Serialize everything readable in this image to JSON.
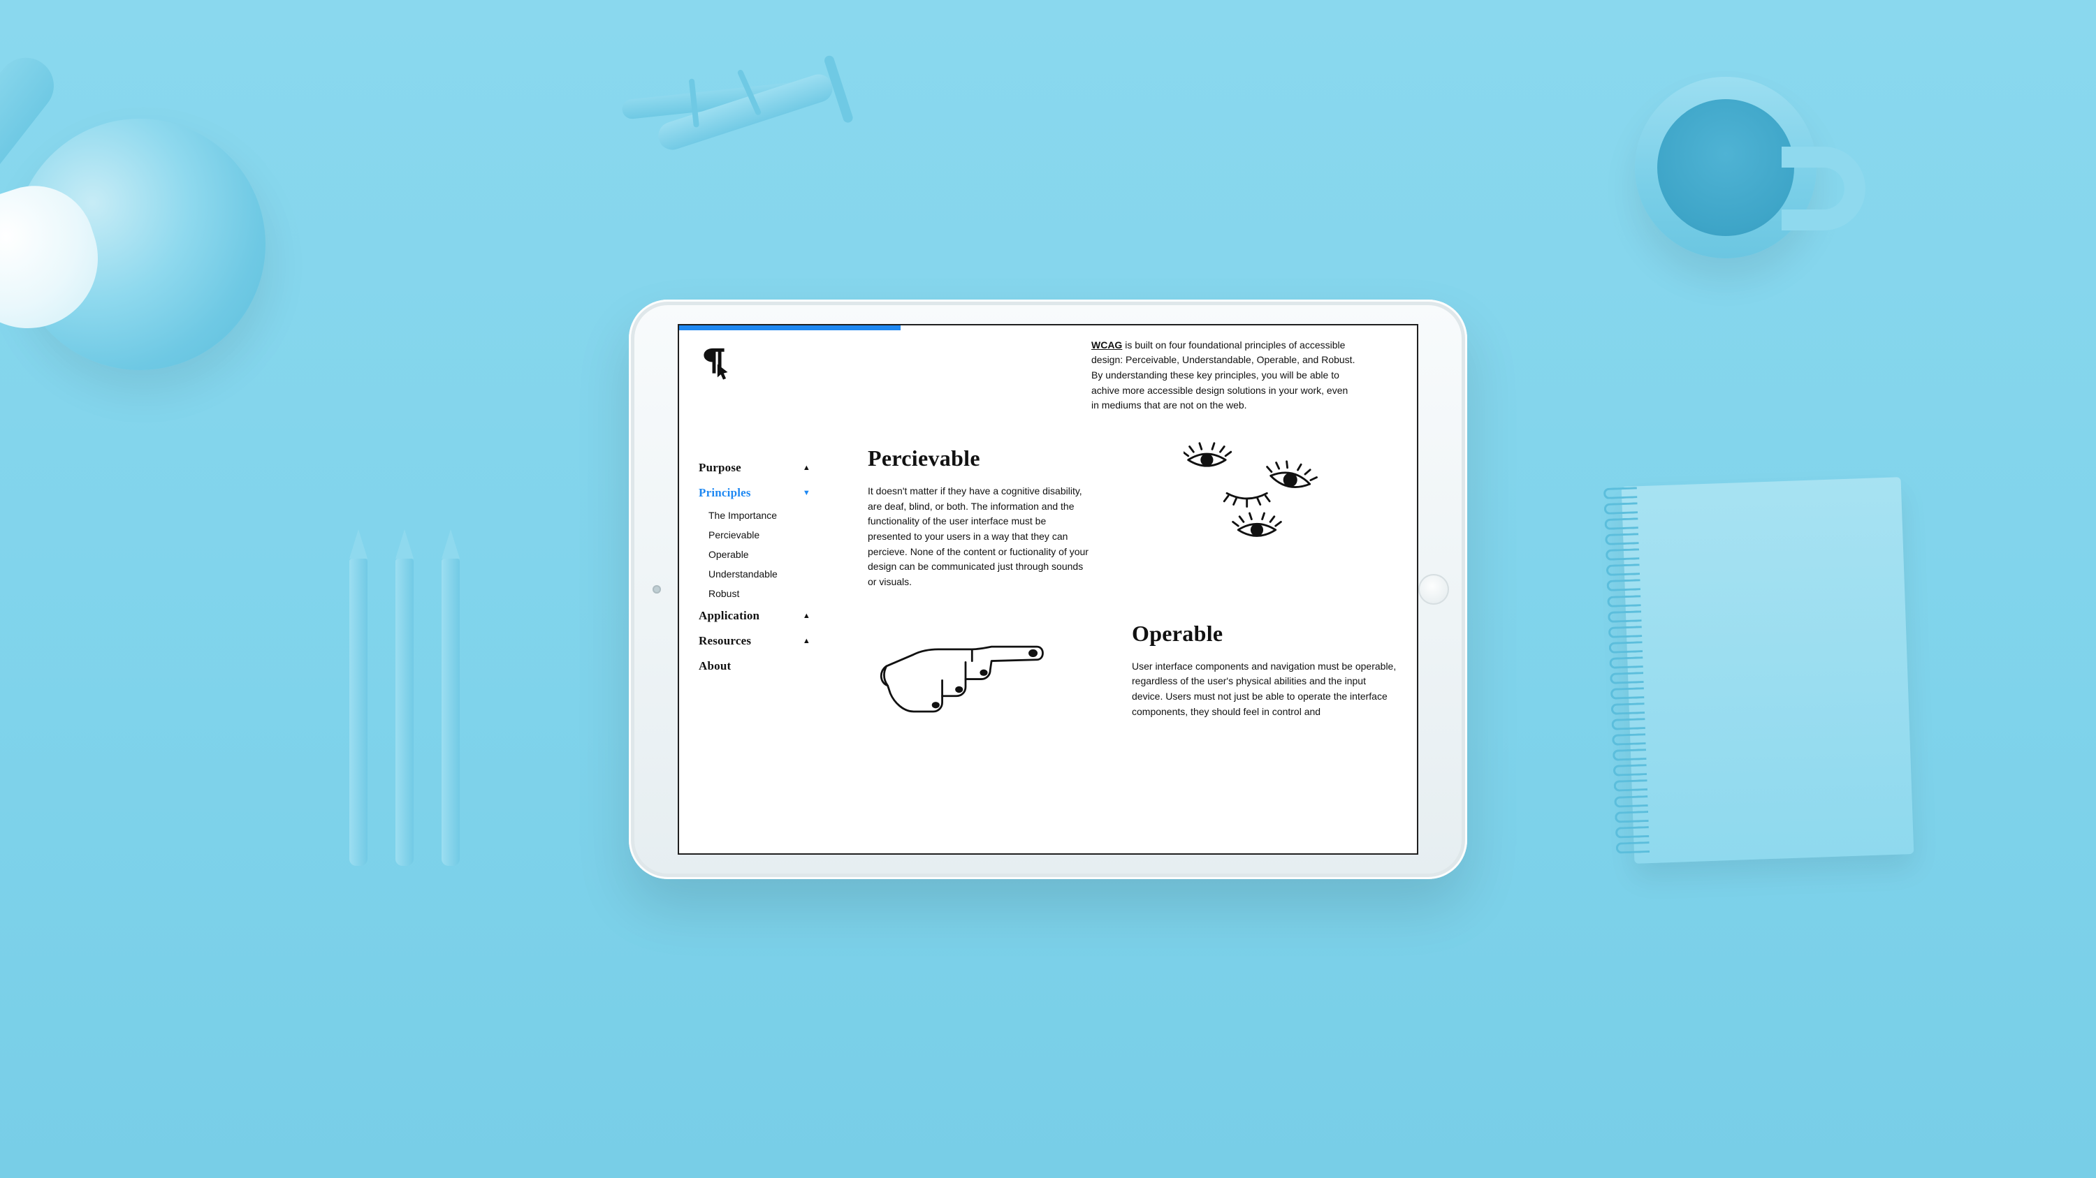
{
  "progress_percent": 30,
  "sidebar": {
    "items": [
      {
        "label": "Purpose",
        "state": "collapsed",
        "chevron": "▲"
      },
      {
        "label": "Principles",
        "state": "expanded",
        "chevron": "▼",
        "active": true,
        "children": [
          {
            "label": "The Importance"
          },
          {
            "label": "Percievable"
          },
          {
            "label": "Operable"
          },
          {
            "label": "Understandable"
          },
          {
            "label": "Robust"
          }
        ]
      },
      {
        "label": "Application",
        "state": "collapsed",
        "chevron": "▲"
      },
      {
        "label": "Resources",
        "state": "collapsed",
        "chevron": "▲"
      },
      {
        "label": "About",
        "state": "none",
        "chevron": ""
      }
    ]
  },
  "intro": {
    "link_text": "WCAG",
    "body": " is built on four foundational principles of accessible design: Perceivable, Understandable, Operable, and Robust. By understanding these key principles, you will be able to achive more accessible design solutions in your work, even in mediums that are not on the web."
  },
  "sections": {
    "perceivable": {
      "title": "Percievable",
      "body": "It doesn't matter if they have a cognitive disability, are deaf, blind, or both. The information and the functionality of the user interface must be presented to your users in a way that they can percieve. None of the content or fuctionality of your design can be communicated just through sounds or visuals.",
      "illustration": "eyes-icon"
    },
    "operable": {
      "title": "Operable",
      "body": "User interface components and navigation must be operable, regardless of the user's physical abilities and the input device. Users must not just be able to operate the interface components, they should feel in control and",
      "illustration": "pointing-hand-icon"
    }
  },
  "colors": {
    "accent": "#1E88F2",
    "scene_bg": "#7FD3EB",
    "text": "#111111"
  }
}
